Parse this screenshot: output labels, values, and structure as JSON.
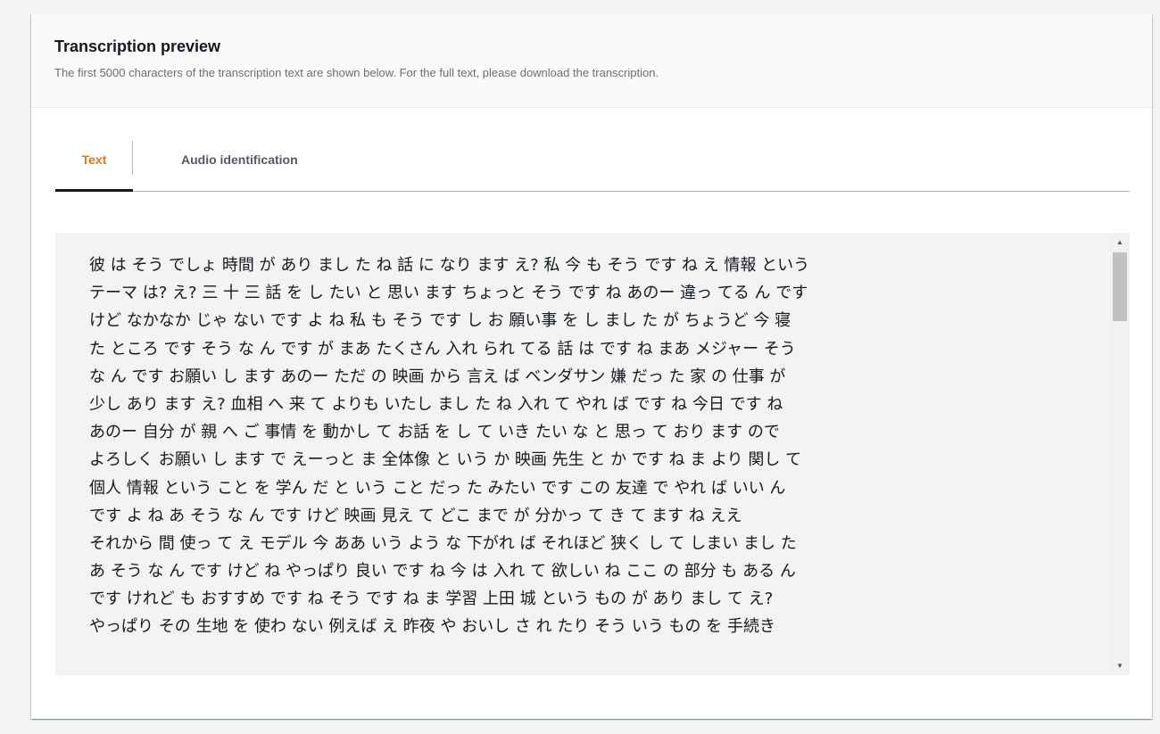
{
  "panel": {
    "title": "Transcription preview",
    "description": "The first 5000 characters of the transcription text are shown below. For the full text, please download the transcription."
  },
  "tabs": [
    {
      "label": "Text",
      "selected": true
    },
    {
      "label": "Audio identification",
      "selected": false
    }
  ],
  "transcript": {
    "lines": [
      "彼 は そう でしょ 時間 が あり まし た ね 話 に なり ます え? 私 今 も そう です ね え 情報 という",
      "テーマ は? え? 三 十 三 話 を し たい と 思い ます ちょっと そう です ね あのー 違っ てる ん です",
      "けど なかなか じゃ ない です よ ね 私 も そう です し お 願い事 を し まし た が ちょうど 今 寝",
      "た ところ です そう な ん です が まあ たくさん 入れ られ てる 話 は です ね まあ メジャー そう",
      "な ん です お願い し ます あのー ただ の 映画 から 言え ば ベンダサン 嫌 だっ た 家 の 仕事 が",
      "少し あり ます え? 血相 へ 来 て よりも いたし まし た ね 入れ て やれ ば です ね 今日 です ね",
      "あのー 自分 が 親 へ ご 事情 を 動かし て お話 を し て いき たい な と 思っ て おり ます ので",
      "よろしく お願い し ます で えーっと ま 全体像 と いう か 映画 先生 と か です ね ま より 関し て",
      "個人 情報 という こと を 学ん だ と いう こと だっ た みたい です この 友達 で やれ ば いい ん",
      "です よ ね あ そう な ん です けど 映画 見え て どこ まで が 分かっ て き て ます ね ええ",
      "それから 間 使っ て え モデル 今 ああ いう よう な 下がれ ば それほど 狭く し て しまい まし た",
      "あ そう な ん です けど ね やっぱり 良い です ね 今 は 入れ て 欲しい ね ここ の 部分 も ある ん",
      "です けれど も おすすめ です ね そう です ね ま 学習 上田 城 という もの が あり まし て え?",
      "やっぱり その 生地 を 使わ ない 例えば え 昨夜 や おいし さ れ たり そう いう もの を 手続き"
    ]
  },
  "scrollbar": {
    "up_icon": "▲",
    "down_icon": "▼"
  },
  "colors": {
    "accent": "#ec7211",
    "tab_underline": "#16191f",
    "background": "#f2f3f3"
  }
}
